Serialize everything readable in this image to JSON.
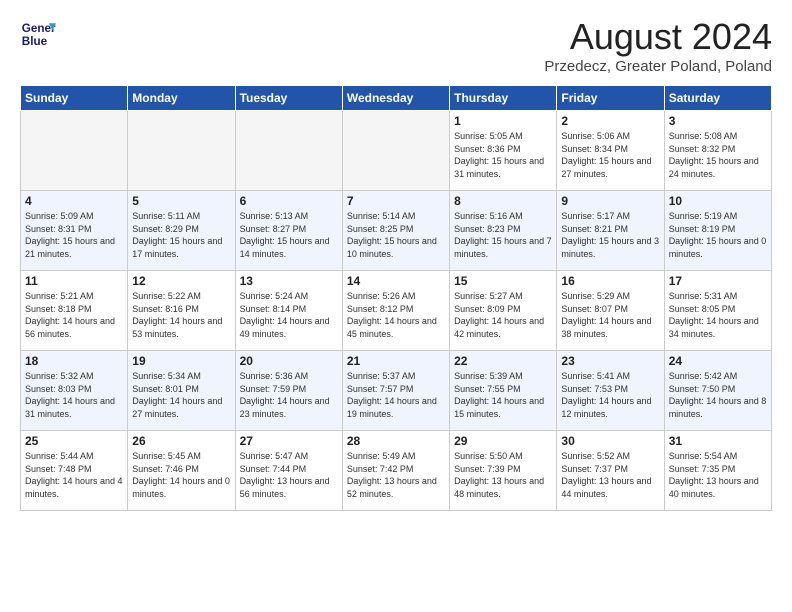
{
  "header": {
    "logo_line1": "General",
    "logo_line2": "Blue",
    "title": "August 2024",
    "location": "Przedecz, Greater Poland, Poland"
  },
  "weekdays": [
    "Sunday",
    "Monday",
    "Tuesday",
    "Wednesday",
    "Thursday",
    "Friday",
    "Saturday"
  ],
  "weeks": [
    [
      {
        "day": "",
        "empty": true
      },
      {
        "day": "",
        "empty": true
      },
      {
        "day": "",
        "empty": true
      },
      {
        "day": "",
        "empty": true
      },
      {
        "day": "1",
        "sunrise": "5:05 AM",
        "sunset": "8:36 PM",
        "daylight": "15 hours and 31 minutes."
      },
      {
        "day": "2",
        "sunrise": "5:06 AM",
        "sunset": "8:34 PM",
        "daylight": "15 hours and 27 minutes."
      },
      {
        "day": "3",
        "sunrise": "5:08 AM",
        "sunset": "8:32 PM",
        "daylight": "15 hours and 24 minutes."
      }
    ],
    [
      {
        "day": "4",
        "sunrise": "5:09 AM",
        "sunset": "8:31 PM",
        "daylight": "15 hours and 21 minutes."
      },
      {
        "day": "5",
        "sunrise": "5:11 AM",
        "sunset": "8:29 PM",
        "daylight": "15 hours and 17 minutes."
      },
      {
        "day": "6",
        "sunrise": "5:13 AM",
        "sunset": "8:27 PM",
        "daylight": "15 hours and 14 minutes."
      },
      {
        "day": "7",
        "sunrise": "5:14 AM",
        "sunset": "8:25 PM",
        "daylight": "15 hours and 10 minutes."
      },
      {
        "day": "8",
        "sunrise": "5:16 AM",
        "sunset": "8:23 PM",
        "daylight": "15 hours and 7 minutes."
      },
      {
        "day": "9",
        "sunrise": "5:17 AM",
        "sunset": "8:21 PM",
        "daylight": "15 hours and 3 minutes."
      },
      {
        "day": "10",
        "sunrise": "5:19 AM",
        "sunset": "8:19 PM",
        "daylight": "15 hours and 0 minutes."
      }
    ],
    [
      {
        "day": "11",
        "sunrise": "5:21 AM",
        "sunset": "8:18 PM",
        "daylight": "14 hours and 56 minutes."
      },
      {
        "day": "12",
        "sunrise": "5:22 AM",
        "sunset": "8:16 PM",
        "daylight": "14 hours and 53 minutes."
      },
      {
        "day": "13",
        "sunrise": "5:24 AM",
        "sunset": "8:14 PM",
        "daylight": "14 hours and 49 minutes."
      },
      {
        "day": "14",
        "sunrise": "5:26 AM",
        "sunset": "8:12 PM",
        "daylight": "14 hours and 45 minutes."
      },
      {
        "day": "15",
        "sunrise": "5:27 AM",
        "sunset": "8:09 PM",
        "daylight": "14 hours and 42 minutes."
      },
      {
        "day": "16",
        "sunrise": "5:29 AM",
        "sunset": "8:07 PM",
        "daylight": "14 hours and 38 minutes."
      },
      {
        "day": "17",
        "sunrise": "5:31 AM",
        "sunset": "8:05 PM",
        "daylight": "14 hours and 34 minutes."
      }
    ],
    [
      {
        "day": "18",
        "sunrise": "5:32 AM",
        "sunset": "8:03 PM",
        "daylight": "14 hours and 31 minutes."
      },
      {
        "day": "19",
        "sunrise": "5:34 AM",
        "sunset": "8:01 PM",
        "daylight": "14 hours and 27 minutes."
      },
      {
        "day": "20",
        "sunrise": "5:36 AM",
        "sunset": "7:59 PM",
        "daylight": "14 hours and 23 minutes."
      },
      {
        "day": "21",
        "sunrise": "5:37 AM",
        "sunset": "7:57 PM",
        "daylight": "14 hours and 19 minutes."
      },
      {
        "day": "22",
        "sunrise": "5:39 AM",
        "sunset": "7:55 PM",
        "daylight": "14 hours and 15 minutes."
      },
      {
        "day": "23",
        "sunrise": "5:41 AM",
        "sunset": "7:53 PM",
        "daylight": "14 hours and 12 minutes."
      },
      {
        "day": "24",
        "sunrise": "5:42 AM",
        "sunset": "7:50 PM",
        "daylight": "14 hours and 8 minutes."
      }
    ],
    [
      {
        "day": "25",
        "sunrise": "5:44 AM",
        "sunset": "7:48 PM",
        "daylight": "14 hours and 4 minutes."
      },
      {
        "day": "26",
        "sunrise": "5:45 AM",
        "sunset": "7:46 PM",
        "daylight": "14 hours and 0 minutes."
      },
      {
        "day": "27",
        "sunrise": "5:47 AM",
        "sunset": "7:44 PM",
        "daylight": "13 hours and 56 minutes."
      },
      {
        "day": "28",
        "sunrise": "5:49 AM",
        "sunset": "7:42 PM",
        "daylight": "13 hours and 52 minutes."
      },
      {
        "day": "29",
        "sunrise": "5:50 AM",
        "sunset": "7:39 PM",
        "daylight": "13 hours and 48 minutes."
      },
      {
        "day": "30",
        "sunrise": "5:52 AM",
        "sunset": "7:37 PM",
        "daylight": "13 hours and 44 minutes."
      },
      {
        "day": "31",
        "sunrise": "5:54 AM",
        "sunset": "7:35 PM",
        "daylight": "13 hours and 40 minutes."
      }
    ]
  ]
}
